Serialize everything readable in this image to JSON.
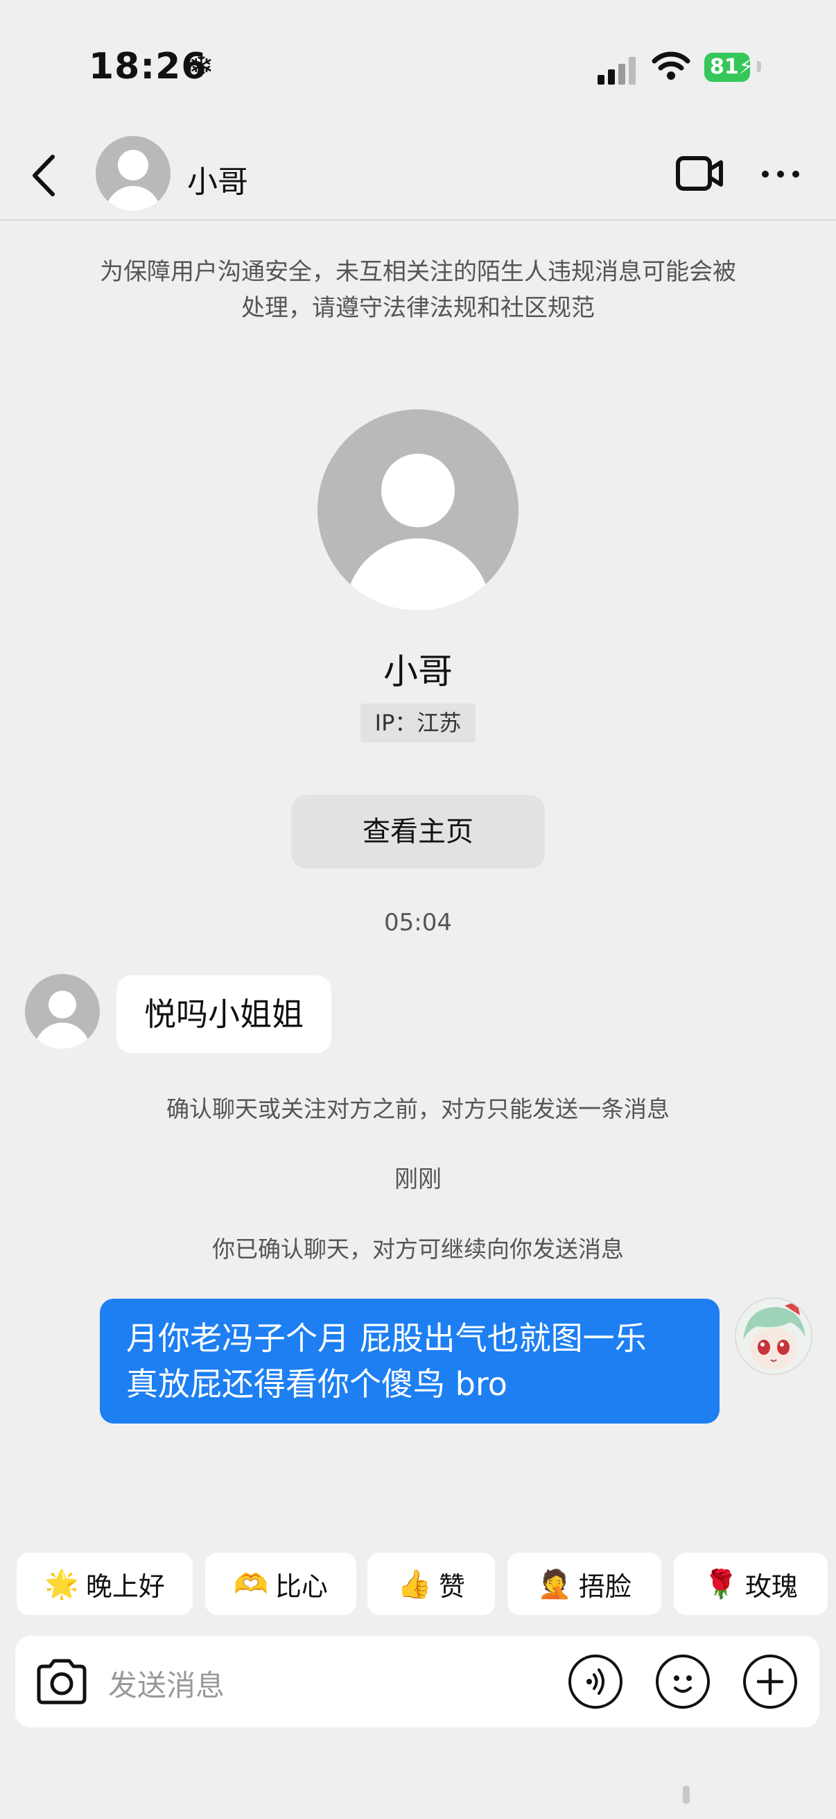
{
  "status_bar": {
    "time": "18:26",
    "battery": "81"
  },
  "header": {
    "name": "小哥"
  },
  "notice": "为保障用户沟通安全，未互相关注的陌生人违规消息可能会被处理，请遵守法律法规和社区规范",
  "profile": {
    "name": "小哥",
    "ip": "IP：江苏",
    "home_button": "查看主页"
  },
  "messages": {
    "time1": "05:04",
    "incoming": "悦吗小姐姐",
    "system1": "确认聊天或关注对方之前，对方只能发送一条消息",
    "time2": "刚刚",
    "system2": "你已确认聊天，对方可继续向你发送消息",
    "outgoing_line1": "月你老冯子个月 屁股出气也就图一乐",
    "outgoing_line2": "真放屁还得看你个傻鸟 bro"
  },
  "quick_replies": [
    {
      "emoji": "🌟",
      "label": "晚上好"
    },
    {
      "emoji": "🫶",
      "label": "比心"
    },
    {
      "emoji": "👍",
      "label": "赞"
    },
    {
      "emoji": "🤦",
      "label": "捂脸"
    },
    {
      "emoji": "🌹",
      "label": "玫瑰"
    }
  ],
  "input": {
    "placeholder": "发送消息"
  },
  "icons": {
    "back": "chevron-left-icon",
    "video": "video-camera-icon",
    "more": "more-icon",
    "camera": "camera-icon",
    "voice": "voice-icon",
    "emoji": "emoji-icon",
    "plus": "plus-icon"
  },
  "colors": {
    "bubble_out": "#1d7ff2",
    "battery": "#35c759",
    "background": "#efefef"
  }
}
